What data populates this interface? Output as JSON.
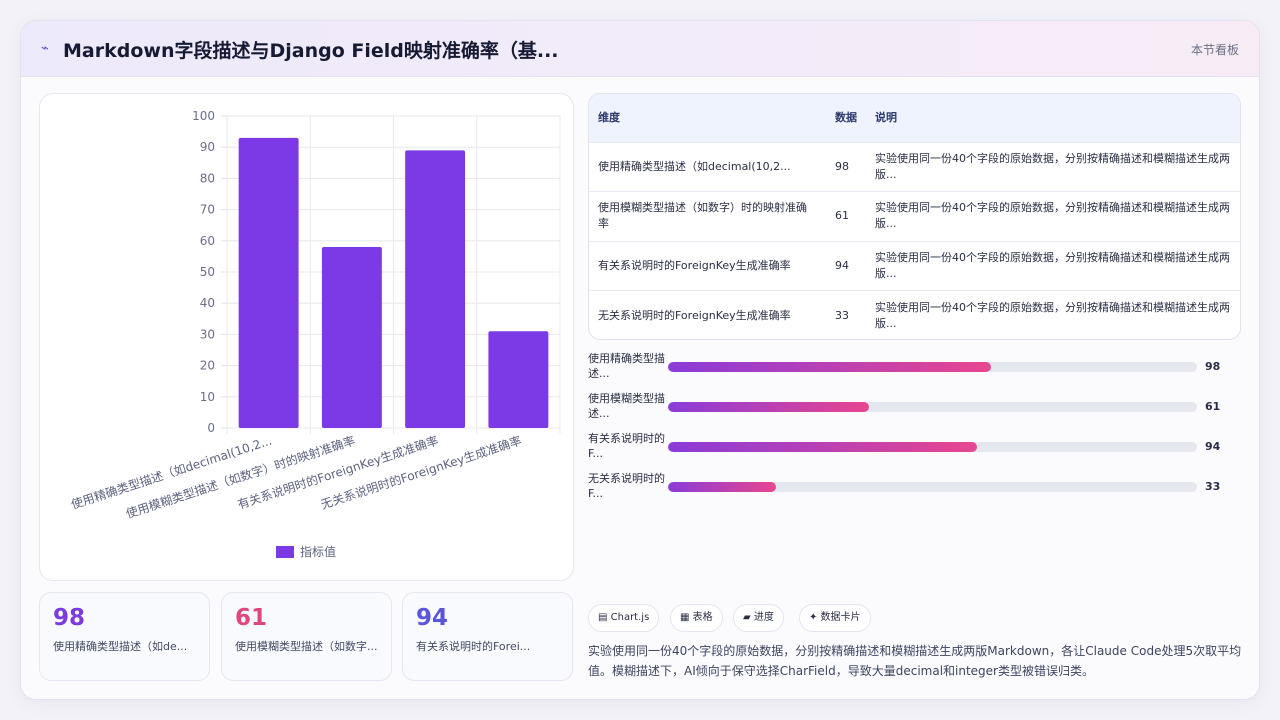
{
  "header": {
    "logo_icon": "chart-sparkline-icon",
    "title": "Markdown字段描述与Django Field映射准确率（基...",
    "board_link": "本节看板"
  },
  "chart_data": {
    "type": "bar",
    "categories": [
      "使用精确类型描述（如decimal(10,2...",
      "使用模糊类型描述（如数字）时的映射准确率",
      "有关系说明时的ForeignKey生成准确率",
      "无关系说明时的ForeignKey生成准确率"
    ],
    "series": [
      {
        "name": "指标值",
        "values": [
          93,
          58,
          89,
          31
        ]
      }
    ],
    "ylim": [
      0,
      100
    ],
    "yticks": [
      0,
      10,
      20,
      30,
      40,
      50,
      60,
      70,
      80,
      90,
      100
    ],
    "grid": true,
    "legend": "bottom",
    "color": "#7b3ae6"
  },
  "table": {
    "headers": [
      "维度",
      "数据",
      "说明"
    ],
    "rows": [
      [
        "使用精确类型描述（如decimal(10,2...",
        "98",
        "实验使用同一份40个字段的原始数据，分别按精确描述和模糊描述生成两版..."
      ],
      [
        "使用模糊类型描述（如数字）时的映射准确率",
        "61",
        "实验使用同一份40个字段的原始数据，分别按精确描述和模糊描述生成两版..."
      ],
      [
        "有关系说明时的ForeignKey生成准确率",
        "94",
        "实验使用同一份40个字段的原始数据，分别按精确描述和模糊描述生成两版..."
      ],
      [
        "无关系说明时的ForeignKey生成准确率",
        "33",
        "实验使用同一份40个字段的原始数据，分别按精确描述和模糊描述生成两版..."
      ]
    ]
  },
  "progress": [
    {
      "label": "使用精确类型描述...",
      "value": 98,
      "fraction": 0.61
    },
    {
      "label": "使用模糊类型描述...",
      "value": 61,
      "fraction": 0.38
    },
    {
      "label": "有关系说明时的F...",
      "value": 94,
      "fraction": 0.585
    },
    {
      "label": "无关系说明时的F...",
      "value": 33,
      "fraction": 0.205
    }
  ],
  "stats": [
    {
      "value": "98",
      "label": "使用精确类型描述（如de...",
      "color": "#7a3be0"
    },
    {
      "value": "61",
      "label": "使用模糊类型描述（如数字...",
      "color": "#e0457f"
    },
    {
      "value": "94",
      "label": "有关系说明时的Forei...",
      "color": "#5a56d9"
    }
  ],
  "chips": [
    "▤ Chart.js",
    "▦ 表格",
    "▰ 进度",
    "✦ 数据卡片"
  ],
  "description": "实验使用同一份40个字段的原始数据，分别按精确描述和模糊描述生成两版Markdown，各让Claude Code处理5次取平均值。模糊描述下，AI倾向于保守选择CharField，导致大量decimal和integer类型被错误归类。"
}
